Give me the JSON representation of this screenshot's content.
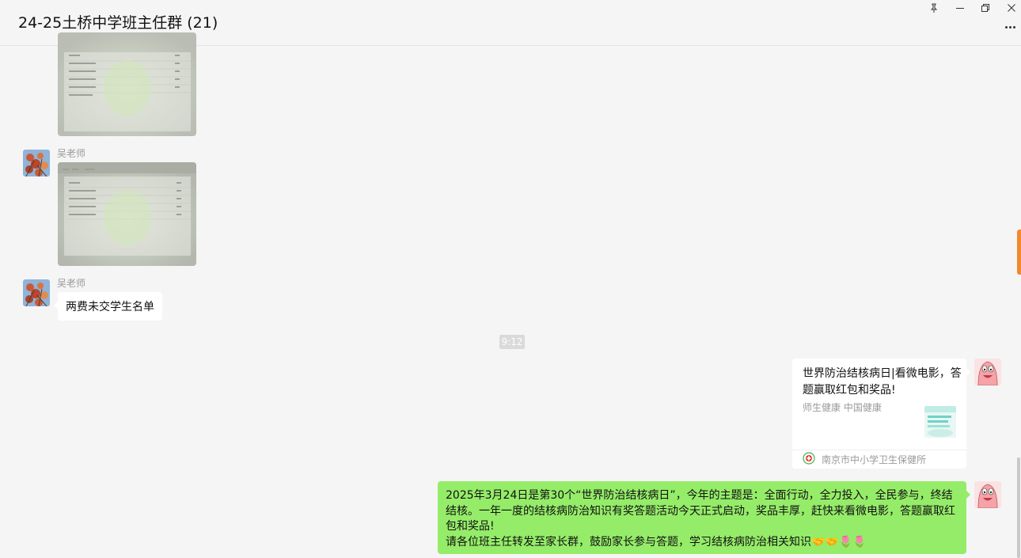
{
  "window": {
    "title": "24-25土桥中学班主任群 (21)"
  },
  "messages": [
    {
      "type": "image",
      "sender": ""
    },
    {
      "type": "image",
      "sender": "吴老师"
    },
    {
      "type": "text",
      "sender": "吴老师",
      "text": "两费未交学生名单"
    }
  ],
  "timestamp": "9:12",
  "link_card": {
    "title": "世界防治结核病日|看微电影，答题赢取红包和奖品!",
    "desc": "师生健康  中国健康",
    "source": "南京市中小学卫生保健所",
    "thumb_colors": [
      "#6fd3c6",
      "#e9f7f4"
    ]
  },
  "own_message": {
    "line1": "2025年3月24日是第30个“世界防治结核病日”，今年的主题是：全面行动，全力投入，全民参与，终结结核。一年一度的结核病防治知识有奖答题活动今天正式启动，奖品丰厚，赶快来看微电影，答题赢取红包和奖品!",
    "line2": "请各位班主任转发至家长群，鼓励家长参与答题，学习结核病防治相关知识🤝🤝🌷🌷"
  },
  "colors": {
    "accent_green": "#95ec69",
    "side_tab": "#f08a2c"
  }
}
